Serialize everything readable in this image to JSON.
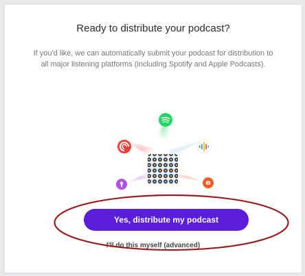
{
  "dialog": {
    "title": "Ready to distribute your podcast?",
    "description": "If you'd like, we can automatically submit your podcast for distribution to all major listening platforms (including Spotify and Apple Podcasts).",
    "primary_label": "Yes, distribute my podcast",
    "secondary_label": "I'll do this myself (advanced)"
  },
  "illustration": {
    "platform_icons": [
      "spotify-icon",
      "google-podcasts-icon",
      "pocket-casts-icon",
      "apple-podcasts-icon",
      "castbox-icon"
    ],
    "colors": {
      "spotify": "#1ed760",
      "google": "#4285f4",
      "pocketcasts": "#f43e37",
      "apple": "#b150e2",
      "castbox": "#f55b23"
    }
  },
  "colors": {
    "accent": "#5b1ddc",
    "annotation": "#9b1c1c"
  }
}
